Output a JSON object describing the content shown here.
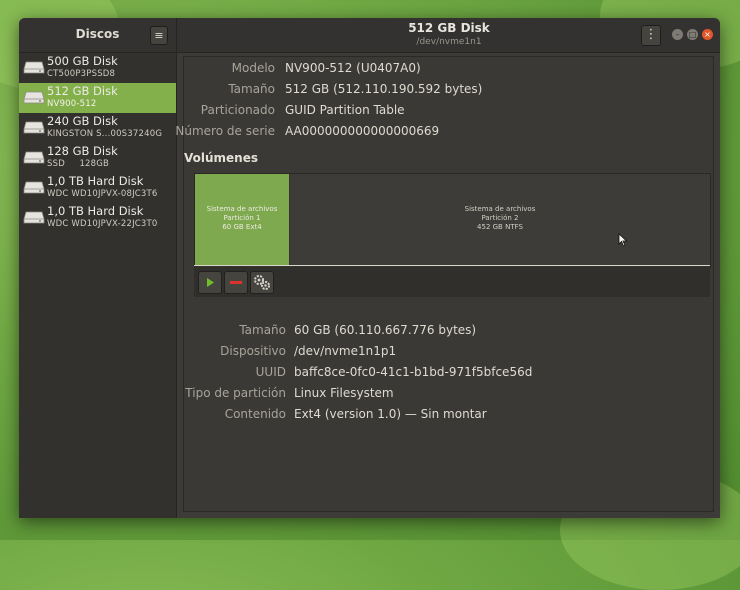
{
  "sidebar": {
    "title": "Discos",
    "disks": [
      {
        "name": "500 GB Disk",
        "model": "CT500P3PSSD8",
        "selected": false
      },
      {
        "name": "512 GB Disk",
        "model": "NV900-512",
        "selected": true
      },
      {
        "name": "240 GB Disk",
        "model": "KINGSTON S...00S37240G",
        "selected": false
      },
      {
        "name": "128 GB Disk",
        "model": "SSD     128GB",
        "selected": false
      },
      {
        "name": "1,0 TB Hard Disk",
        "model": "WDC WD10JPVX-08JC3T6",
        "selected": false
      },
      {
        "name": "1,0 TB Hard Disk",
        "model": "WDC WD10JPVX-22JC3T0",
        "selected": false
      }
    ]
  },
  "header": {
    "title": "512 GB Disk",
    "subtitle": "/dev/nvme1n1"
  },
  "disk_info": [
    {
      "label": "Modelo",
      "value": "NV900-512 (U0407A0)"
    },
    {
      "label": "Tamaño",
      "value": "512 GB (512.110.190.592 bytes)"
    },
    {
      "label": "Particionado",
      "value": "GUID Partition Table"
    },
    {
      "label": "Número de serie",
      "value": "AA000000000000000669"
    }
  ],
  "volumes": {
    "title": "Volúmenes",
    "partitions": [
      {
        "line1": "Sistema de archivos",
        "line2": "Partición 1",
        "line3": "60 GB Ext4",
        "selected": true
      },
      {
        "line1": "Sistema de archivos",
        "line2": "Partición 2",
        "line3": "452 GB NTFS",
        "selected": false
      }
    ]
  },
  "partition_info": [
    {
      "label": "Tamaño",
      "value": "60 GB (60.110.667.776 bytes)"
    },
    {
      "label": "Dispositivo",
      "value": "/dev/nvme1n1p1"
    },
    {
      "label": "UUID",
      "value": "baffc8ce-0fc0-41c1-b1bd-971f5bfce56d"
    },
    {
      "label": "Tipo de partición",
      "value": "Linux Filesystem"
    },
    {
      "label": "Contenido",
      "value": "Ext4 (version 1.0) — Sin montar"
    }
  ],
  "icons": {
    "mount": "play-icon",
    "delete": "minus-icon",
    "more": "gears-icon",
    "menu": "hamburger-icon",
    "options": "kebab-icon"
  },
  "colors": {
    "accent": "#83b04a",
    "window_bg": "#3c3b37",
    "close_button": "#e2572c"
  }
}
